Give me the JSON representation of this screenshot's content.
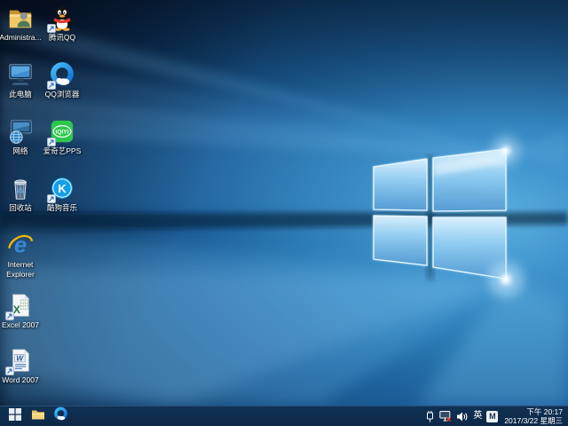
{
  "desktop": {
    "icons": [
      {
        "name": "user-folder",
        "label": "Administra..."
      },
      {
        "name": "tencent-qq",
        "label": "腾讯QQ"
      },
      {
        "name": "this-pc",
        "label": "此电脑"
      },
      {
        "name": "qq-browser",
        "label": "QQ浏览器"
      },
      {
        "name": "network",
        "label": "网络"
      },
      {
        "name": "iqiyi-pps",
        "label": "爱奇艺PPS",
        "glyph": "iQIYI"
      },
      {
        "name": "recycle-bin",
        "label": "回收站"
      },
      {
        "name": "kugou-music",
        "label": "酷狗音乐",
        "glyph": "K"
      },
      {
        "name": "internet-explorer",
        "label": "Internet Explorer",
        "glyph": "e"
      },
      {
        "name": "excel-2007",
        "label": "Excel 2007",
        "glyph": "X"
      },
      {
        "name": "word-2007",
        "label": "Word 2007",
        "glyph": "W"
      }
    ]
  },
  "taskbar": {
    "buttons": [
      {
        "name": "start-button",
        "icon": "windows-logo-icon"
      },
      {
        "name": "file-explorer-button",
        "icon": "folder-icon"
      },
      {
        "name": "qq-browser-button",
        "icon": "qq-browser-icon"
      }
    ],
    "tray": {
      "icons": [
        {
          "name": "usb-device-icon"
        },
        {
          "name": "network-disconnected-icon"
        },
        {
          "name": "volume-icon"
        }
      ],
      "language_indicator": "英",
      "ime_indicator": "M",
      "clock": {
        "time": "下午 20:17",
        "date": "2017/3/22 星期三"
      }
    }
  },
  "colors": {
    "taskbar": "#0e2b4c",
    "wallpaper_glow": "#59aede",
    "wallpaper_dark": "#06142a",
    "label_text": "#ffffff"
  }
}
